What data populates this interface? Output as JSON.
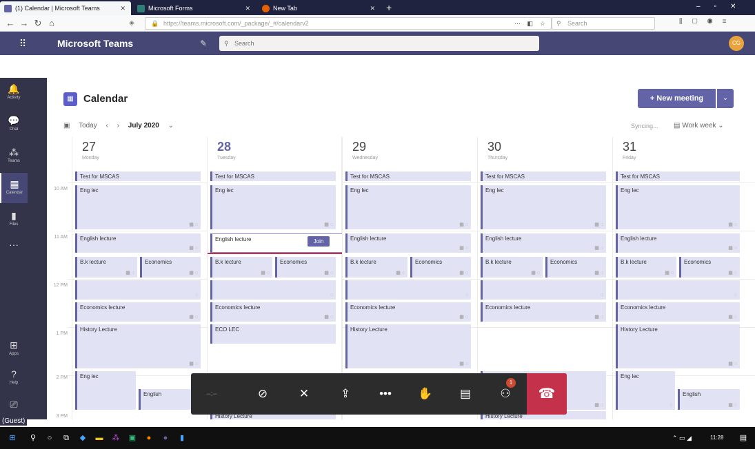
{
  "browser": {
    "tabs": [
      {
        "label": "(1) Calendar | Microsoft Teams",
        "color": "#6264a7"
      },
      {
        "label": "Microsoft Forms",
        "color": "#2f7d75"
      },
      {
        "label": "New Tab",
        "color": "#e66000"
      }
    ],
    "new_tab": "+",
    "url": "https://teams.microsoft.com/_package/_#/calendarv2",
    "search_placeholder": "Search",
    "url_menu": "···"
  },
  "teams": {
    "app_title": "Microsoft Teams",
    "search_placeholder": "Search",
    "avatar_initials": "CG"
  },
  "rail": [
    {
      "label": "Activity",
      "glyph": "🔔"
    },
    {
      "label": "Chat",
      "glyph": "💬"
    },
    {
      "label": "Teams",
      "glyph": "⁂"
    },
    {
      "label": "Calendar",
      "glyph": "▦"
    },
    {
      "label": "Files",
      "glyph": "▮"
    },
    {
      "label": "",
      "glyph": "···"
    }
  ],
  "rail_bottom": [
    {
      "label": "Apps",
      "glyph": "⊞"
    },
    {
      "label": "Help",
      "glyph": "?"
    }
  ],
  "guest_label": "(Guest)",
  "calendar": {
    "title": "Calendar",
    "new_meeting": "+ New meeting",
    "today": "Today",
    "month": "July 2020",
    "syncing": "Syncing...",
    "view": "Work week",
    "times": [
      "10 AM",
      "11 AM",
      "12 PM",
      "1 PM",
      "2 PM",
      "3 PM"
    ],
    "days": [
      {
        "num": "27",
        "name": "Monday"
      },
      {
        "num": "28",
        "name": "Tuesday"
      },
      {
        "num": "29",
        "name": "Wednesday"
      },
      {
        "num": "30",
        "name": "Thursday"
      },
      {
        "num": "31",
        "name": "Friday"
      }
    ],
    "join_label": "Join"
  },
  "events": {
    "mscas": "Test for MSCAS",
    "eng_lec": "Eng lec",
    "english_lecture": "English lecture",
    "bk_lecture": "B.k lecture",
    "economics": "Economics",
    "economics_lecture": "Economics lecture",
    "history_lecture": "History Lecture",
    "eco_lec": "ECO LEC",
    "english": "English"
  },
  "taskbar": {
    "time": "11:28"
  },
  "call_controls": {
    "participants_badge": "1"
  }
}
